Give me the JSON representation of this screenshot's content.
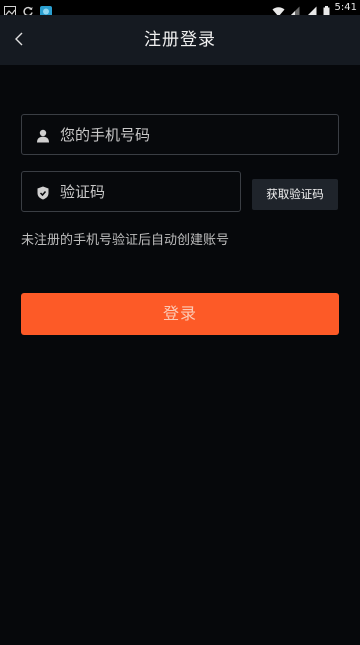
{
  "status_bar": {
    "time": "5:41",
    "left_icons": [
      "image-icon",
      "sync-icon",
      "app-icon"
    ],
    "right_icons": [
      "wifi-icon",
      "signal-icon",
      "signal-icon",
      "battery-icon"
    ]
  },
  "header": {
    "title": "注册登录",
    "back_icon": "chevron-left-icon"
  },
  "form": {
    "phone": {
      "placeholder": "您的手机号码",
      "value": "",
      "icon": "user-icon"
    },
    "code": {
      "placeholder": "验证码",
      "value": "",
      "icon": "shield-icon"
    },
    "get_code_label": "获取验证码",
    "hint": "未注册的手机号验证后自动创建账号",
    "submit_label": "登录"
  },
  "colors": {
    "background": "#06080b",
    "header": "#151a21",
    "accent": "#fd5a27",
    "button_dark": "#1f242b"
  }
}
